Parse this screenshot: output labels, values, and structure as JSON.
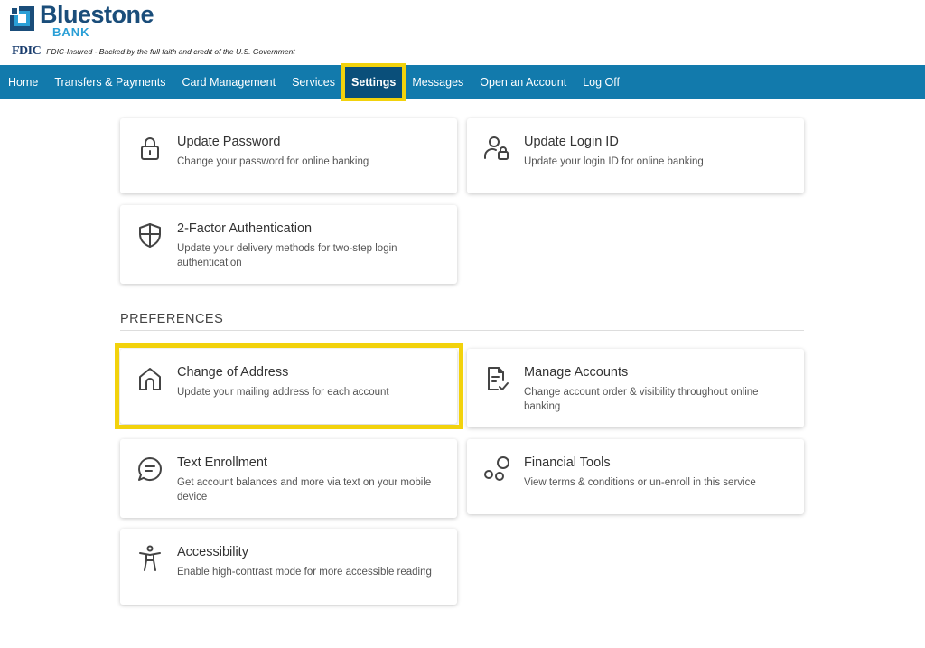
{
  "brand": {
    "name": "Bluestone",
    "sub": "BANK"
  },
  "fdic": {
    "logo": "FDIC",
    "text": "FDIC-Insured - Backed by the full faith and credit of the U.S. Government"
  },
  "nav": {
    "items": [
      {
        "label": "Home"
      },
      {
        "label": "Transfers & Payments"
      },
      {
        "label": "Card Management"
      },
      {
        "label": "Services"
      },
      {
        "label": "Settings"
      },
      {
        "label": "Messages"
      },
      {
        "label": "Open an Account"
      },
      {
        "label": "Log Off"
      }
    ]
  },
  "security": {
    "cards": [
      {
        "icon": "lock-icon",
        "title": "Update Password",
        "desc": "Change your password for online banking"
      },
      {
        "icon": "user-lock-icon",
        "title": "Update Login ID",
        "desc": "Update your login ID for online banking"
      },
      {
        "icon": "shield-icon",
        "title": "2-Factor Authentication",
        "desc": "Update your delivery methods for two-step login authentication"
      }
    ]
  },
  "preferences": {
    "title": "PREFERENCES",
    "cards": [
      {
        "icon": "house-icon",
        "title": "Change of Address",
        "desc": "Update your mailing address for each account"
      },
      {
        "icon": "document-check-icon",
        "title": "Manage Accounts",
        "desc": "Change account order & visibility throughout online banking"
      },
      {
        "icon": "chat-icon",
        "title": "Text Enrollment",
        "desc": "Get account balances and more via text on your mobile device"
      },
      {
        "icon": "bubbles-icon",
        "title": "Financial Tools",
        "desc": "View terms & conditions or un-enroll in this service"
      },
      {
        "icon": "accessibility-icon",
        "title": "Accessibility",
        "desc": "Enable high-contrast mode for more accessible reading"
      }
    ]
  },
  "colors": {
    "nav": "#127aac",
    "highlight": "#f2d20c",
    "brand": "#1a4d7a",
    "accent": "#2a9fd6"
  }
}
